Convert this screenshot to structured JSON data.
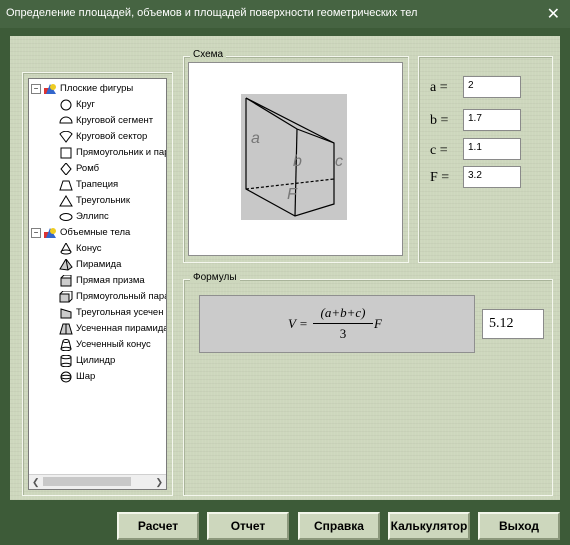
{
  "window": {
    "title": "Определение площадей, объемов и площадей поверхности геометрических тел",
    "close_glyph": "✕"
  },
  "tree": {
    "groups": [
      {
        "label": "Плоские фигуры",
        "expander": "−",
        "items": [
          {
            "label": "Круг",
            "icon": "circle-icon"
          },
          {
            "label": "Круговой сегмент",
            "icon": "circle-segment-icon"
          },
          {
            "label": "Круговой сектор",
            "icon": "circle-sector-icon"
          },
          {
            "label": "Прямоугольник и пар",
            "icon": "rectangle-icon"
          },
          {
            "label": "Ромб",
            "icon": "rhombus-icon"
          },
          {
            "label": "Трапеция",
            "icon": "trapezoid-icon"
          },
          {
            "label": "Треугольник",
            "icon": "triangle-icon"
          },
          {
            "label": "Эллипс",
            "icon": "ellipse-icon"
          }
        ]
      },
      {
        "label": "Объемные тела",
        "expander": "−",
        "items": [
          {
            "label": "Конус",
            "icon": "cone-icon"
          },
          {
            "label": "Пирамида",
            "icon": "pyramid-icon"
          },
          {
            "label": "Прямая призма",
            "icon": "prism-icon"
          },
          {
            "label": "Прямоугольный пара",
            "icon": "parallelepiped-icon"
          },
          {
            "label": "Треугольная усечен",
            "icon": "truncated-prism-icon"
          },
          {
            "label": "Усеченная пирамида",
            "icon": "truncated-pyramid-icon"
          },
          {
            "label": "Усеченный конус",
            "icon": "truncated-cone-icon"
          },
          {
            "label": "Цилиндр",
            "icon": "cylinder-icon"
          },
          {
            "label": "Шар",
            "icon": "sphere-icon"
          }
        ]
      }
    ]
  },
  "scheme": {
    "legend": "Схема",
    "edge_labels": {
      "a": "a",
      "b": "b",
      "c": "c",
      "F": "F"
    }
  },
  "params": [
    {
      "label": "a =",
      "value": "2"
    },
    {
      "label": "b =",
      "value": "1.7"
    },
    {
      "label": "c =",
      "value": "1.1"
    },
    {
      "label": "F =",
      "value": "3.2"
    }
  ],
  "formulas": {
    "legend": "Формулы",
    "lhs": "V =",
    "numerator": "(a+b+c)",
    "denominator": "3",
    "factor": "F",
    "result": "5.12"
  },
  "buttons": [
    {
      "label": "Расчет",
      "name": "calculate-button"
    },
    {
      "label": "Отчет",
      "name": "report-button"
    },
    {
      "label": "Справка",
      "name": "help-button"
    },
    {
      "label": "Калькулятор",
      "name": "calculator-button"
    },
    {
      "label": "Выход",
      "name": "exit-button"
    }
  ]
}
